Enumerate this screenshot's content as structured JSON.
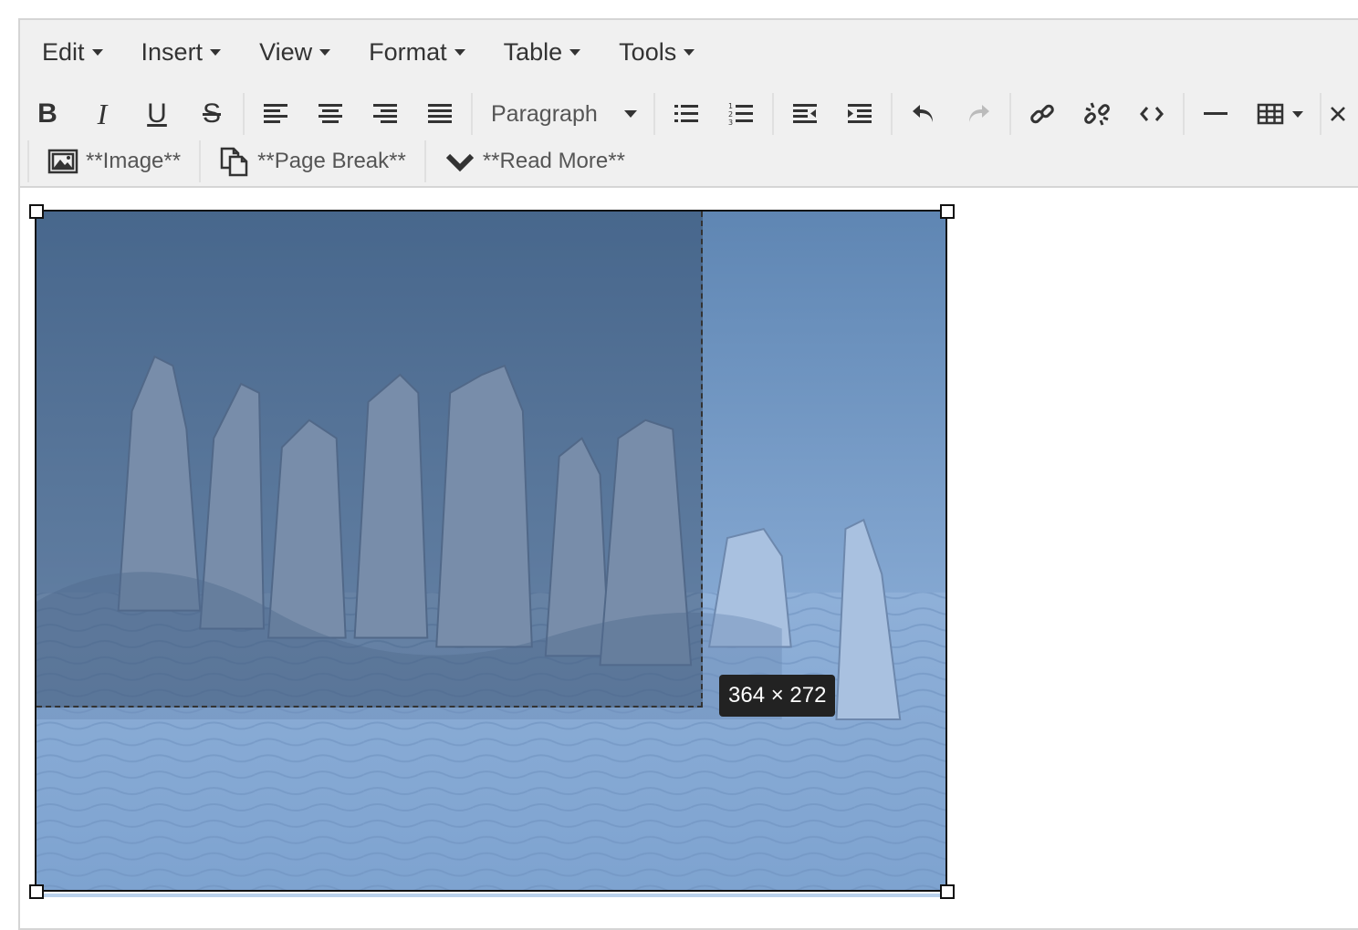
{
  "menubar": {
    "items": [
      {
        "label": "Edit"
      },
      {
        "label": "Insert"
      },
      {
        "label": "View"
      },
      {
        "label": "Format"
      },
      {
        "label": "Table"
      },
      {
        "label": "Tools"
      }
    ]
  },
  "toolbar": {
    "bold_label": "B",
    "italic_label": "I",
    "underline_label": "U",
    "strike_label": "S",
    "block_format": "Paragraph",
    "image_label": "**Image**",
    "page_break_label": "**Page Break**",
    "read_more_label": "**Read More**",
    "icons": [
      "align-left-icon",
      "align-center-icon",
      "align-right-icon",
      "align-justify-icon",
      "bullet-list-icon",
      "numbered-list-icon",
      "outdent-icon",
      "indent-icon",
      "undo-icon",
      "redo-icon",
      "link-icon",
      "unlink-icon",
      "code-icon",
      "horizontal-rule-icon",
      "table-icon",
      "close-icon"
    ]
  },
  "content": {
    "resize_tooltip": "364 × 272"
  },
  "colors": {
    "toolbar_bg": "#f0f0f0",
    "border": "#d5d5d5",
    "tooltip_bg": "#222222"
  }
}
